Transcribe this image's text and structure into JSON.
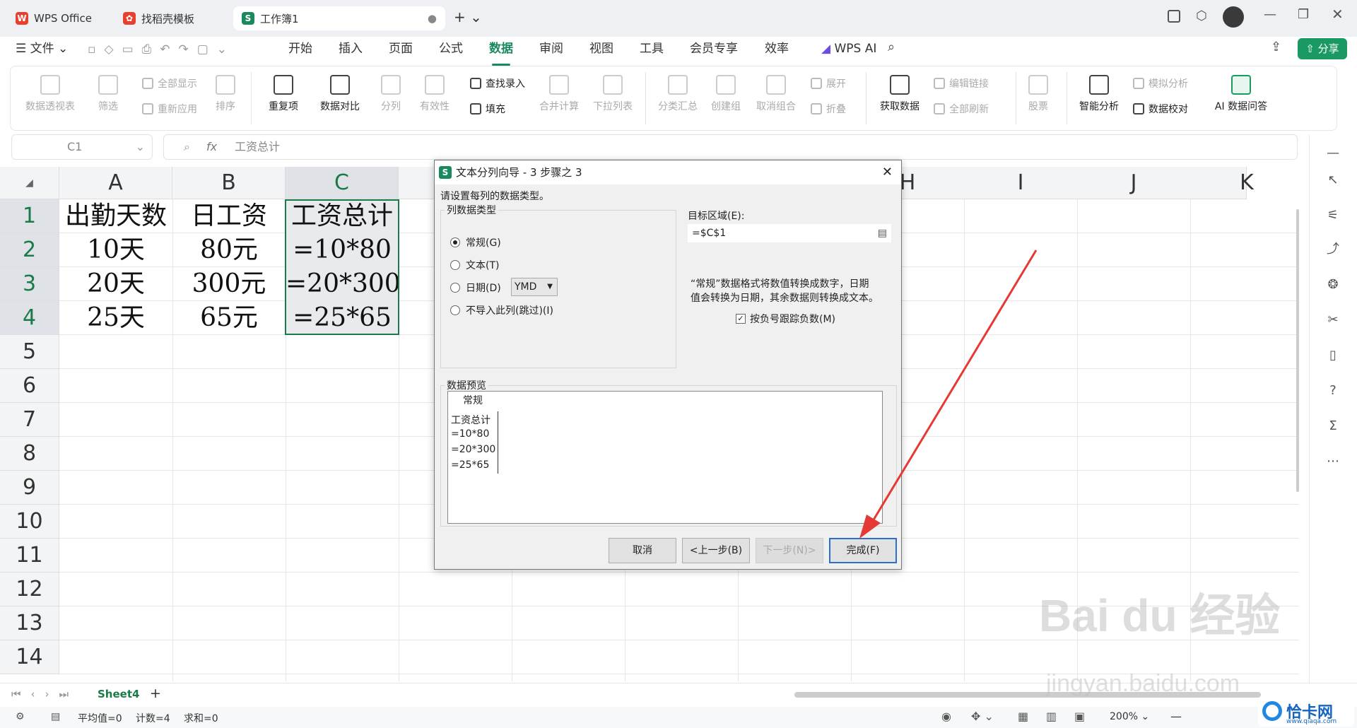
{
  "tabs": {
    "wps": "WPS Office",
    "template": "找稻壳模板",
    "book": "工作簿1",
    "plus": "+ ⌄"
  },
  "menu": {
    "file": "文件",
    "items": [
      "开始",
      "插入",
      "页面",
      "公式",
      "数据",
      "审阅",
      "视图",
      "工具",
      "会员专享",
      "效率"
    ],
    "wpsai": "WPS AI",
    "share": "分享"
  },
  "ribbon": {
    "pivot": "数据透视表",
    "filter": "筛选",
    "showall": "全部显示",
    "reapply": "重新应用",
    "sort": "排序",
    "dup": "重复项",
    "compare": "数据对比",
    "split": "分列",
    "valid": "有效性",
    "lookup": "查找录入",
    "fill": "填充",
    "consolidate": "合并计算",
    "dropdown": "下拉列表",
    "subtotal": "分类汇总",
    "group": "创建组",
    "ungroup": "取消组合",
    "expand": "展开",
    "collapse": "折叠",
    "getdata": "获取数据",
    "editlinks": "编辑链接",
    "refreshall": "全部刷新",
    "stock": "股票",
    "smart": "智能分析",
    "simulate": "模拟分析",
    "check": "数据校对",
    "aiqa": "AI 数据问答"
  },
  "formula": {
    "cellref": "C1",
    "fx": "fx",
    "content": "工资总计"
  },
  "columns": [
    "A",
    "B",
    "C",
    "",
    "",
    "",
    "",
    "",
    "H",
    "I",
    "J",
    "K"
  ],
  "rows": [
    "1",
    "2",
    "3",
    "4",
    "5",
    "6",
    "7",
    "8",
    "9",
    "10",
    "11",
    "12",
    "13",
    "14"
  ],
  "cells": {
    "a": [
      "出勤天数",
      "10天",
      "20天",
      "25天"
    ],
    "b": [
      "日工资",
      "80元",
      "300元",
      "65元"
    ],
    "c": [
      "工资总计",
      "=10*80",
      "=20*300",
      "=25*65"
    ]
  },
  "dialog": {
    "title": "文本分列向导 - 3 步骤之 3",
    "instruction": "请设置每列的数据类型。",
    "coltype_label": "列数据类型",
    "radio_general": "常规(G)",
    "radio_text": "文本(T)",
    "radio_date": "日期(D)",
    "date_format": "YMD",
    "radio_skip": "不导入此列(跳过)(I)",
    "target_label": "目标区域(E):",
    "target_value": "=$C$1",
    "desc1": "“常规”数据格式将数值转换成数字，日期",
    "desc2": "值会转换为日期，其余数据则转换成文本。",
    "checkbox": "按负号跟踪负数(M)",
    "preview_label": "数据预览",
    "preview_header": "常规",
    "preview_rows": [
      "工资总计",
      "=10*80",
      "=20*300",
      "=25*65"
    ],
    "cancel": "取消",
    "back": "<上一步(B)",
    "next": "下一步(N)>",
    "finish": "完成(F)"
  },
  "sheet_tab": "Sheet4",
  "status": {
    "avg": "平均值=0",
    "count": "计数=4",
    "sum": "求和=0",
    "zoom": "200%"
  },
  "watermark": {
    "brand": "Bai du 经验",
    "url": "jingyan.baidu.com",
    "site": "恰卡网",
    "site_url": "www.qiaqa.com"
  },
  "colors": {
    "accent": "#1a8a5e",
    "arrow": "#e53935"
  }
}
